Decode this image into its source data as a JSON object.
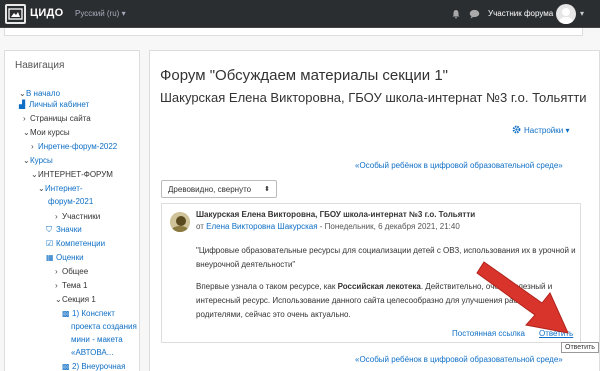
{
  "navbar": {
    "site_name": "ЦИДО",
    "language": "Русский (ru) ▾",
    "user_name": "Участник форума",
    "icons": [
      "logo-icon",
      "bell-icon",
      "chat-icon",
      "avatar",
      "chevron-down-icon"
    ]
  },
  "nav": {
    "title": "Навигация",
    "items": [
      {
        "label": "В начало",
        "link": true,
        "icon": "chevron-down"
      },
      {
        "label": "Личный кабинет",
        "link": true,
        "icon": "dashboard-icon"
      },
      {
        "label": "Страницы сайта",
        "link": false,
        "icon": "chevron-right"
      },
      {
        "label": "Мои курсы",
        "link": false,
        "icon": "chevron-down"
      },
      {
        "label": "Инретне-форум-2022",
        "link": true,
        "icon": "chevron-right"
      },
      {
        "label": "Курсы",
        "link": true,
        "icon": "chevron-down"
      },
      {
        "label": "ИНТЕРНЕТ-ФОРУМ",
        "link": false,
        "icon": "chevron-down"
      },
      {
        "label": "Интернет-",
        "link": true,
        "icon": "chevron-down"
      },
      {
        "label": "форум-2021",
        "link": true,
        "icon": ""
      },
      {
        "label": "Участники",
        "link": false,
        "icon": "chevron-right"
      },
      {
        "label": "Значки",
        "link": true,
        "icon": "badge-icon"
      },
      {
        "label": "Компетенции",
        "link": true,
        "icon": "checklist-icon"
      },
      {
        "label": "Оценки",
        "link": true,
        "icon": "grid-icon"
      },
      {
        "label": "Общее",
        "link": false,
        "icon": "chevron-right"
      },
      {
        "label": "Тема 1",
        "link": false,
        "icon": "chevron-right"
      },
      {
        "label": "Секция 1",
        "link": false,
        "icon": "chevron-down"
      },
      {
        "label": "1) Конспект",
        "link": true,
        "icon": "file-icon"
      },
      {
        "label": "проекта создания",
        "link": true,
        "icon": ""
      },
      {
        "label": "мини - макета",
        "link": true,
        "icon": ""
      },
      {
        "label": "«АВТОВА...",
        "link": true,
        "icon": ""
      },
      {
        "label": "2) Внеурочная",
        "link": true,
        "icon": "file-icon"
      }
    ]
  },
  "main": {
    "forum_title": "Форум \"Обсуждаем материалы секции 1\"",
    "discussion_title": "Шакурская Елена Викторовна, ГБОУ школа-интернат №3 г.о. Тольятти",
    "settings_label": "Настройки ▾",
    "prev_link": "«Особый ребёнок в цифровой образовательной среде»",
    "display_mode": "Древовидно, свернуто",
    "post": {
      "subject": "Шакурская Елена Викторовна, ГБОУ школа-интернат №3 г.о. Тольятти",
      "by_prefix": "от",
      "author": "Елена Викторовна Шакурская",
      "date": "- Понедельник, 6 декабря 2021, 21:40",
      "quote": "\"Цифровые образовательные ресурсы для социализации детей с ОВЗ, использования их в урочной и внеурочной деятельности\"",
      "text_before": "Впервые узнала о таком ресурсе, как ",
      "text_bold": "Российская лекотека",
      "text_after": ". Действительно, очень полезный и интересный ресурс. Использование данного сайта целесообразно для улучшения работы с родителями, сейчас это очень актуально.",
      "permalink_label": "Постоянная ссылка",
      "reply_label": "Ответить"
    },
    "tooltip": "Ответить"
  },
  "colors": {
    "navbar": "#2b2e31",
    "link": "#0f6fc5",
    "arrow": "#d9342b"
  }
}
